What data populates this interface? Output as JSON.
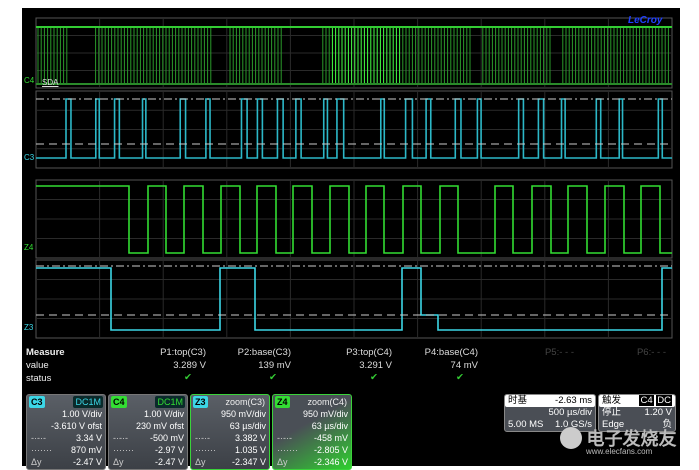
{
  "brand": "LeCroy",
  "channels_labels": {
    "c4": "C4",
    "c3": "C3",
    "z4": "Z4",
    "z3": "Z3",
    "decode": "SDA"
  },
  "measure": {
    "title": "Measure",
    "row_value": "value",
    "row_status": "status",
    "params": [
      {
        "name": "P1:top(C3)",
        "value": "3.289 V",
        "status": "ok"
      },
      {
        "name": "P2:base(C3)",
        "value": "139 mV",
        "status": "ok"
      },
      {
        "name": "P3:top(C4)",
        "value": "3.291 V",
        "status": "ok"
      },
      {
        "name": "P4:base(C4)",
        "value": "74 mV",
        "status": "ok"
      },
      {
        "name": "P5:- - -",
        "value": "",
        "status": ""
      },
      {
        "name": "P6:- - -",
        "value": "",
        "status": ""
      }
    ],
    "check": "✔"
  },
  "channel_boxes": [
    {
      "tag": "C3",
      "coupling": "DC1M",
      "vdiv": "1.00 V/div",
      "line2": "-3.610 V ofst",
      "c1": "3.34 V",
      "c2": "870 mV",
      "dy": "-2.47 V",
      "color": "#3cd6e6"
    },
    {
      "tag": "C4",
      "coupling": "DC1M",
      "vdiv": "1.00 V/div",
      "line2": "230 mV ofst",
      "c1": "-500 mV",
      "c2": "-2.97 V",
      "dy": "-2.47 V",
      "color": "#33dd33"
    },
    {
      "tag": "Z3",
      "coupling": "zoom(C3)",
      "vdiv": "950 mV/div",
      "line2": "63 µs/div",
      "c1": "3.382 V",
      "c2": "1.035 V",
      "dy": "-2.347 V",
      "color": "#3cd6e6"
    },
    {
      "tag": "Z4",
      "coupling": "zoom(C4)",
      "vdiv": "950 mV/div",
      "line2": "63 µs/div",
      "c1": "-458 mV",
      "c2": "-2.805 V",
      "dy": "-2.346 V",
      "color": "#33dd33"
    }
  ],
  "cursor_labels": {
    "c1": "-·-·-",
    "c2": "·······",
    "dy": "Δy"
  },
  "timebase": {
    "title": "时基",
    "delay": "-2.63 ms",
    "tdiv": "500 µs/div",
    "samples": "5.00 MS",
    "rate": "1.0 GS/s"
  },
  "trigger": {
    "title": "触发",
    "source": "C4",
    "coupling": "DC",
    "mode": "停止",
    "level": "1.20 V",
    "type": "Edge",
    "slope": "负"
  },
  "watermark": {
    "text": "电子发烧友",
    "url": "www.elecfans.com"
  }
}
